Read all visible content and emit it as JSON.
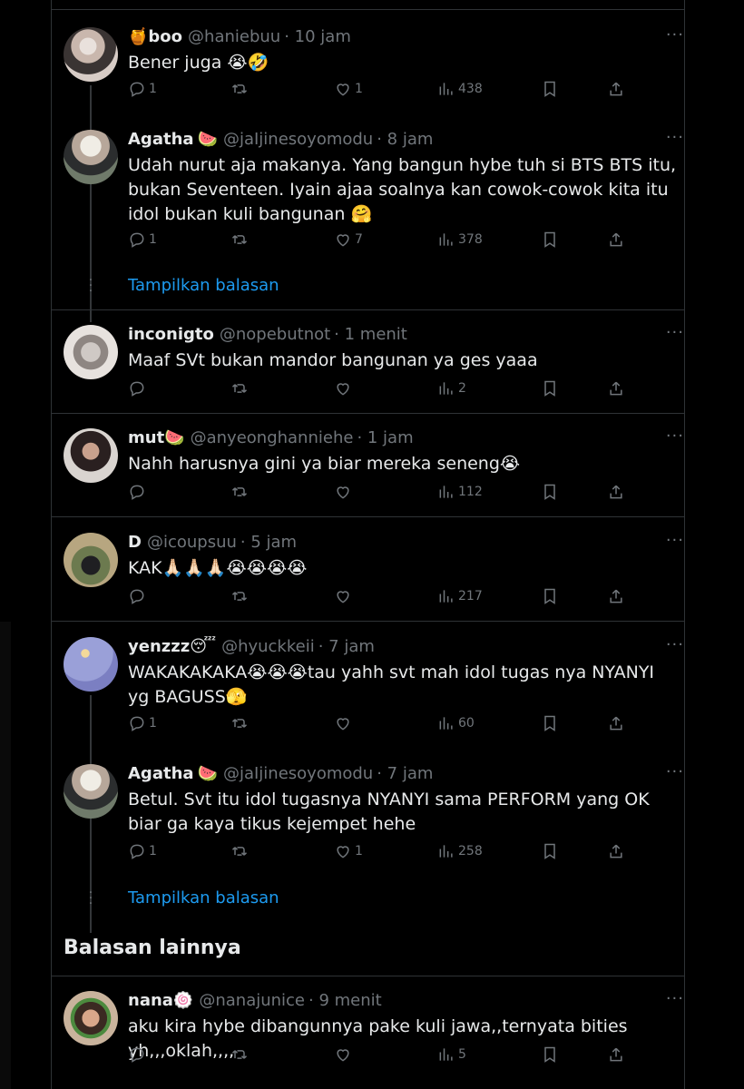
{
  "tweets": [
    {
      "name": "boo",
      "name_emoji": "",
      "prefix_emoji": "🍯",
      "handle": "@haniebuu",
      "time": "· 10 jam",
      "text": "Bener juga 😭🤣",
      "replies": "1",
      "retweets": "",
      "likes": "1",
      "views": "438"
    },
    {
      "name": "Agatha",
      "name_emoji": "🍉",
      "prefix_emoji": "",
      "handle": "@jaIjinesoyomodu",
      "time": "· 8 jam",
      "text": "Udah nurut aja makanya. Yang bangun hybe tuh si BTS BTS itu, bukan Seventeen. Iyain ajaa soalnya kan cowok-cowok kita itu idol bukan kuli bangunan 🤗",
      "replies": "1",
      "retweets": "",
      "likes": "7",
      "views": "378"
    },
    {
      "name": "inconigto",
      "name_emoji": "",
      "prefix_emoji": "",
      "handle": "@nopebutnot",
      "time": "· 1 menit",
      "text": "Maaf SVt bukan mandor bangunan ya ges yaaa",
      "replies": "",
      "retweets": "",
      "likes": "",
      "views": "2"
    },
    {
      "name": "mut",
      "name_emoji": "🍉",
      "prefix_emoji": "",
      "handle": "@anyeonghanniehe",
      "time": "· 1 jam",
      "text": "Nahh harusnya gini ya biar mereka seneng😭",
      "replies": "",
      "retweets": "",
      "likes": "",
      "views": "112"
    },
    {
      "name": "D",
      "name_emoji": "",
      "prefix_emoji": "",
      "handle": "@icoupsuu",
      "time": "· 5 jam",
      "text": "KAK🙏🏻🙏🏻🙏🏻😭😭😭😭",
      "replies": "",
      "retweets": "",
      "likes": "",
      "views": "217"
    },
    {
      "name": "yenzzz",
      "name_emoji": "😴",
      "prefix_emoji": "",
      "handle": "@hyuckkeii",
      "time": "· 7 jam",
      "text": "WAKAKAKAKA😭😭😭tau yahh svt mah idol tugas nya NYANYI yg BAGUSS🫣",
      "replies": "1",
      "retweets": "",
      "likes": "",
      "views": "60"
    },
    {
      "name": "Agatha",
      "name_emoji": "🍉",
      "prefix_emoji": "",
      "handle": "@jaIjinesoyomodu",
      "time": "· 7 jam",
      "text": "Betul. Svt itu idol tugasnya NYANYI sama PERFORM yang OK biar ga kaya tikus kejempet hehe",
      "replies": "1",
      "retweets": "",
      "likes": "1",
      "views": "258"
    },
    {
      "name": "nana",
      "name_emoji": "🍥",
      "prefix_emoji": "",
      "handle": "@nanajunice",
      "time": "· 9 menit",
      "text": "aku kira hybe dibangunnya pake kuli jawa,,ternyata bities yh,,,oklah,,,,",
      "replies": "",
      "retweets": "",
      "likes": "",
      "views": "5"
    }
  ],
  "show_replies_label": "Tampilkan balasan",
  "section_title": "Balasan lainnya",
  "more_icon": "···",
  "colors": {
    "background": "#000000",
    "text": "#e7e9ea",
    "muted": "#71767b",
    "link": "#1d9bf0",
    "border": "#2f3336"
  }
}
